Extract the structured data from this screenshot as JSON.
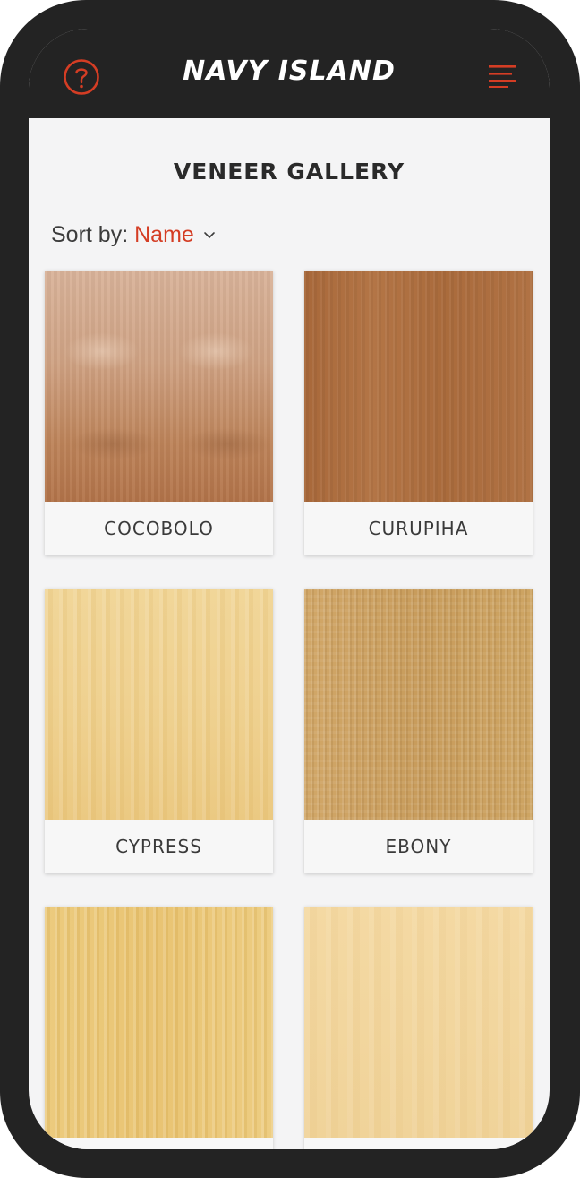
{
  "header": {
    "brand": "NAVY ISLAND",
    "help_icon": "help-circle-icon",
    "menu_icon": "hamburger-menu-icon"
  },
  "page": {
    "title": "VENEER GALLERY"
  },
  "sort": {
    "label": "Sort by:",
    "value": "Name",
    "icon": "chevron-down-icon"
  },
  "gallery": {
    "items": [
      {
        "label": "COCOBOLO"
      },
      {
        "label": "CURUPIHA"
      },
      {
        "label": "CYPRESS"
      },
      {
        "label": "EBONY"
      },
      {
        "label": ""
      },
      {
        "label": ""
      }
    ]
  },
  "colors": {
    "accent": "#d43d24",
    "header_bg": "#232323",
    "page_bg": "#f4f4f5"
  }
}
